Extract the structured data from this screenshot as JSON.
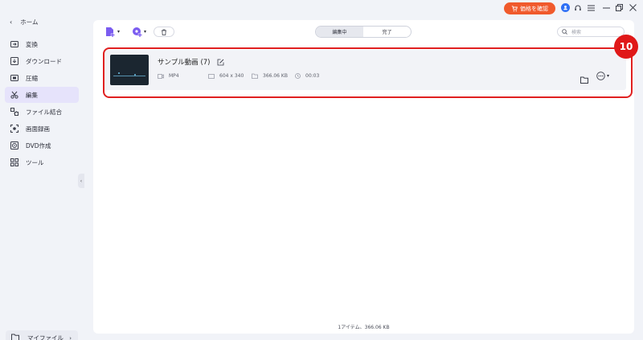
{
  "titlebar": {
    "price_label": "価格を確認",
    "cart_icon": "cart-icon",
    "accent": "#f05a2c"
  },
  "sidebar": {
    "home_label": "ホーム",
    "items": [
      {
        "label": "変換",
        "icon": "convert-icon"
      },
      {
        "label": "ダウンロード",
        "icon": "download-icon"
      },
      {
        "label": "圧縮",
        "icon": "compress-icon"
      },
      {
        "label": "編集",
        "icon": "scissors-icon",
        "active": true
      },
      {
        "label": "ファイル結合",
        "icon": "merge-icon"
      },
      {
        "label": "画面録画",
        "icon": "screen-record-icon"
      },
      {
        "label": "DVD作成",
        "icon": "dvd-icon"
      },
      {
        "label": "ツール",
        "icon": "tools-icon"
      }
    ],
    "my_files_label": "マイファイル",
    "active_bg": "#e6e3fb"
  },
  "toolbar": {
    "tabs": [
      {
        "label": "編集中",
        "active": true
      },
      {
        "label": "完了",
        "active": false
      }
    ],
    "search_placeholder": "検索"
  },
  "file": {
    "name": "サンプル動画 (7)",
    "format": "MP4",
    "resolution": "604 x 340",
    "size": "366.06 KB",
    "duration": "00:03"
  },
  "annotation": {
    "badge": "10",
    "color": "#e01818"
  },
  "footer": {
    "summary": "1アイテム、366.06 KB"
  }
}
